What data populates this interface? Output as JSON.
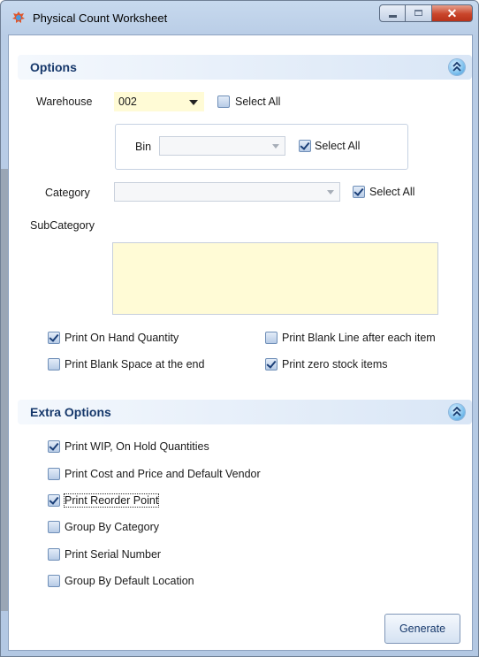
{
  "window": {
    "title": "Physical Count Worksheet"
  },
  "options": {
    "header": "Options",
    "warehouse_label": "Warehouse",
    "warehouse_value": "002",
    "warehouse_select_all": "Select All",
    "bin_label": "Bin",
    "bin_value": "",
    "bin_select_all": "Select All",
    "category_label": "Category",
    "category_value": "",
    "category_select_all": "Select All",
    "subcategory_label": "SubCategory",
    "checks": [
      {
        "label": "Print On Hand Quantity",
        "checked": true
      },
      {
        "label": "Print Blank Line after each item",
        "checked": false
      },
      {
        "label": "Print Blank Space at the end",
        "checked": false
      },
      {
        "label": "Print zero stock items",
        "checked": true
      }
    ]
  },
  "extra_options": {
    "header": "Extra Options",
    "checks": [
      {
        "label": "Print WIP, On Hold Quantities",
        "checked": true
      },
      {
        "label": "Print Cost and Price and Default Vendor",
        "checked": false
      },
      {
        "label": "Print Reorder Point",
        "checked": true
      },
      {
        "label": "Group By Category",
        "checked": false
      },
      {
        "label": "Print Serial Number",
        "checked": false
      },
      {
        "label": "Group By Default Location",
        "checked": false
      }
    ]
  },
  "actions": {
    "generate_label": "Generate"
  },
  "colors": {
    "accent": "#16386b",
    "memo_bg": "#fffbd6",
    "frame": "#b9cde6"
  }
}
